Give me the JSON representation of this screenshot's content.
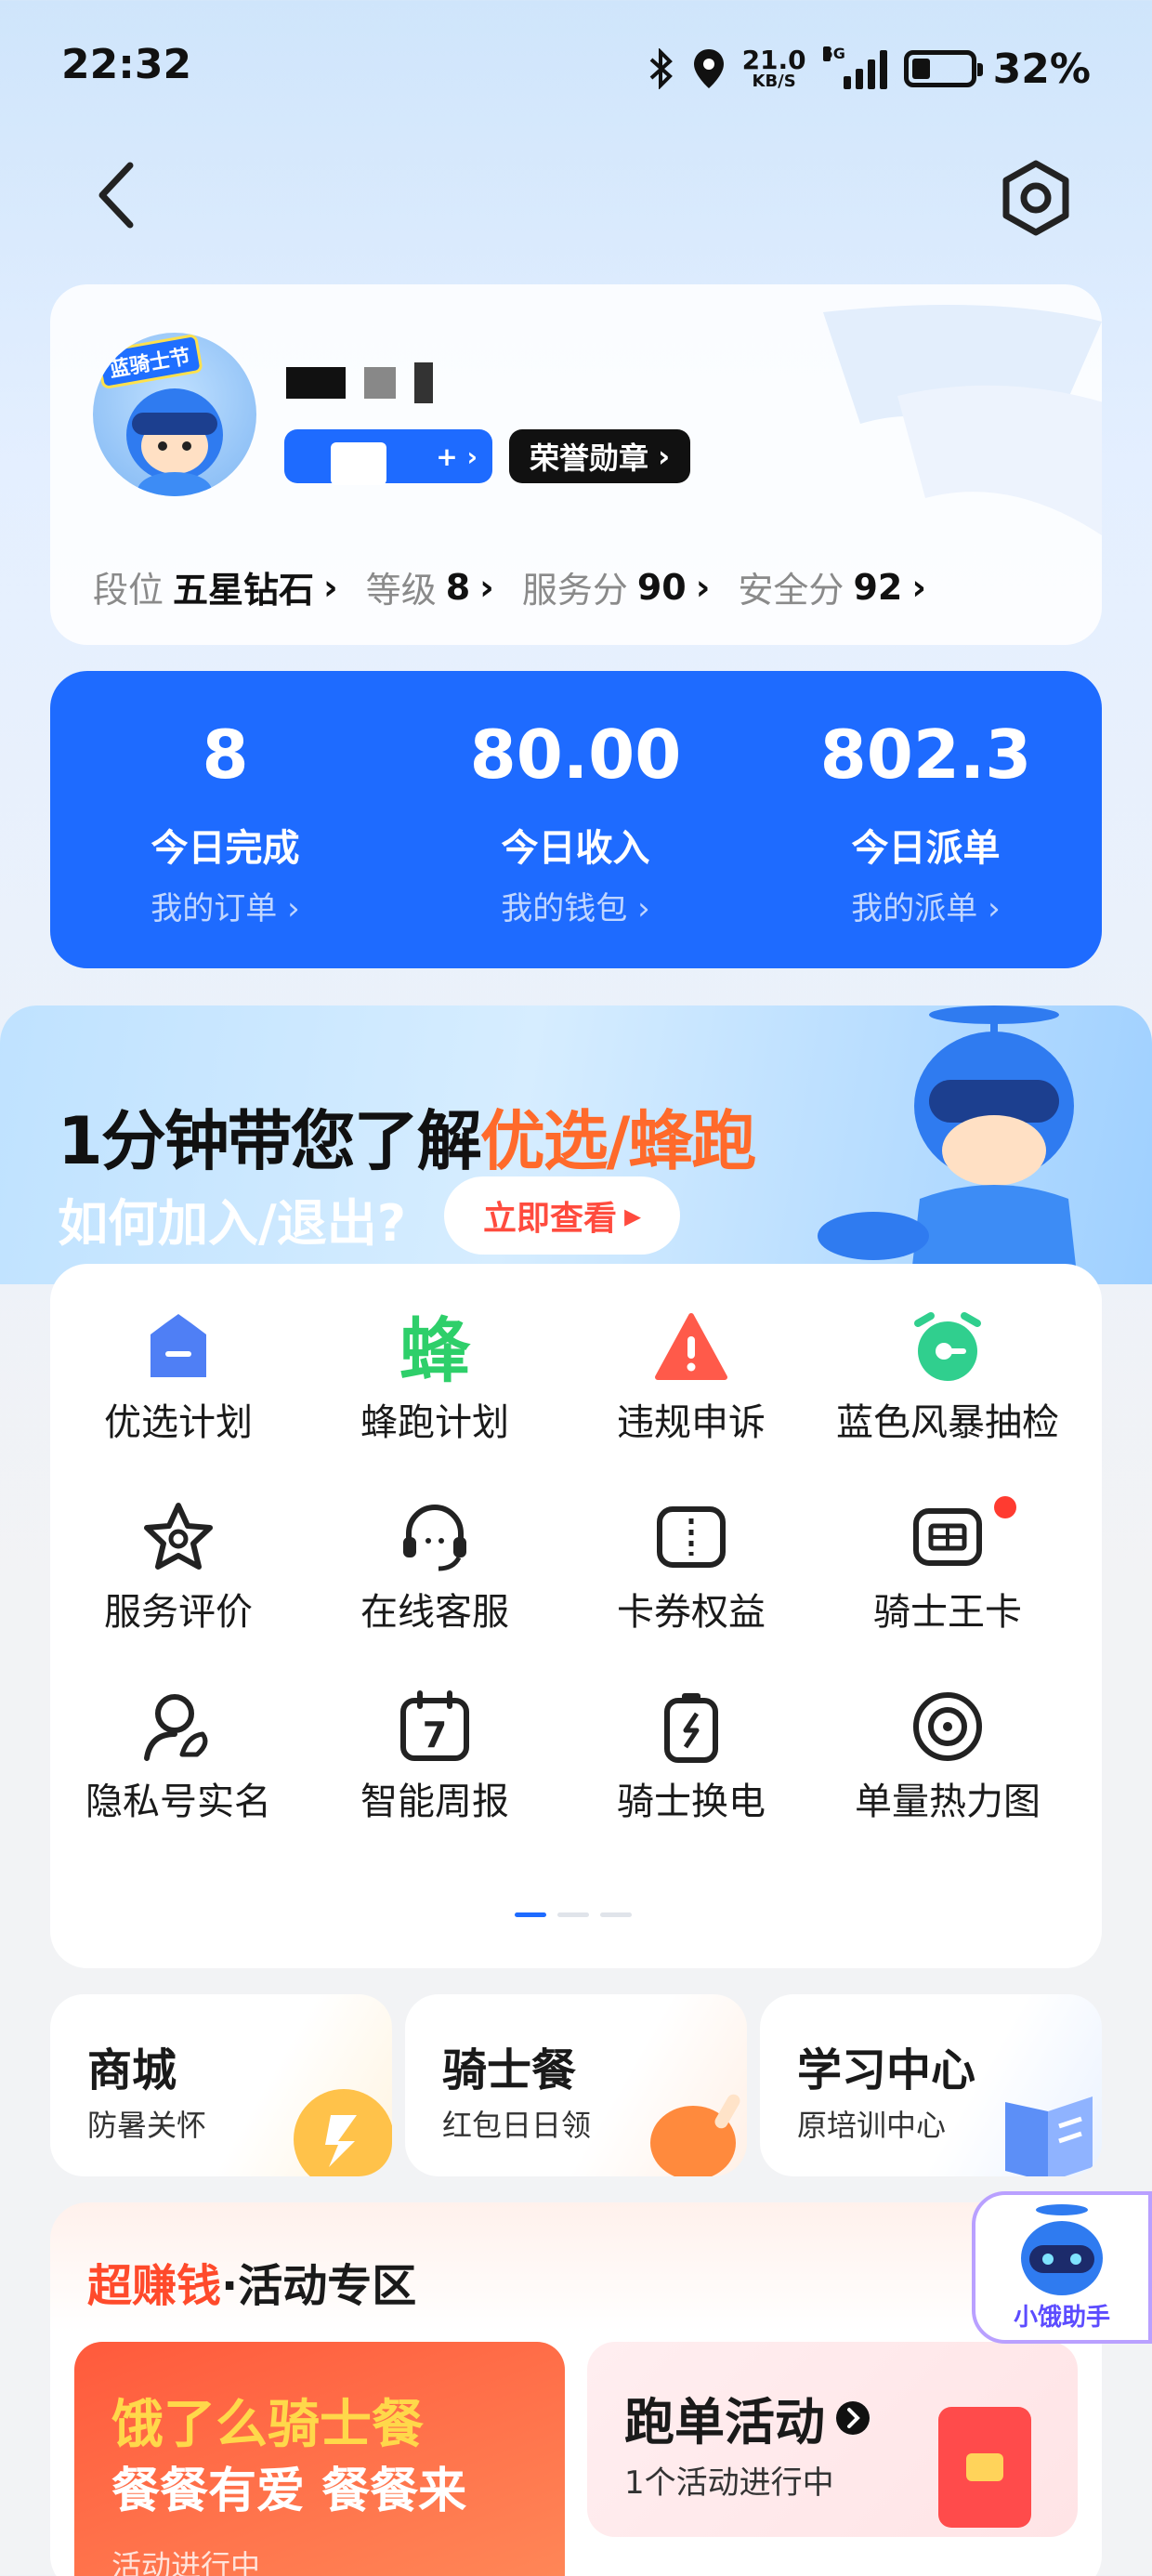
{
  "status": {
    "time": "22:32",
    "net_speed": "21.0",
    "net_unit": "KB/S",
    "network": "5G",
    "battery": "32%",
    "battery_level": 0.32
  },
  "nav": {
    "back": "back",
    "settings": "settings"
  },
  "profile": {
    "avatar_tag": "蓝骑士节",
    "level_suffix": "+",
    "honor": "荣誉勋章",
    "stats": [
      {
        "label": "段位",
        "value": "五星钻石"
      },
      {
        "label": "等级",
        "value": "8"
      },
      {
        "label": "服务分",
        "value": "90"
      },
      {
        "label": "安全分",
        "value": "92"
      }
    ]
  },
  "today": [
    {
      "value": "8",
      "label": "今日完成",
      "link": "我的订单"
    },
    {
      "value": "80.00",
      "label": "今日收入",
      "link": "我的钱包"
    },
    {
      "value": "802.3",
      "label": "今日派单",
      "link": "我的派单"
    }
  ],
  "banner": {
    "title_a": "1分钟带您了解",
    "title_b": "优选/蜂跑",
    "subtitle": "如何加入/退出?",
    "cta": "立即查看"
  },
  "grid": [
    {
      "icon": "crown-icon",
      "label": "优选计划"
    },
    {
      "icon": "bee-char-icon",
      "label": "蜂跑计划",
      "glyph": "蜂"
    },
    {
      "icon": "warning-icon",
      "label": "违规申诉"
    },
    {
      "icon": "alarm-clock-icon",
      "label": "蓝色风暴抽检"
    },
    {
      "icon": "star-badge-icon",
      "label": "服务评价"
    },
    {
      "icon": "headset-icon",
      "label": "在线客服"
    },
    {
      "icon": "coupon-icon",
      "label": "卡券权益"
    },
    {
      "icon": "card-icon",
      "label": "骑士王卡"
    },
    {
      "icon": "user-verify-icon",
      "label": "隐私号实名"
    },
    {
      "icon": "calendar-icon",
      "label": "智能周报",
      "glyph": "7"
    },
    {
      "icon": "battery-swap-icon",
      "label": "骑士换电"
    },
    {
      "icon": "heatmap-icon",
      "label": "单量热力图"
    }
  ],
  "mini_cards": [
    {
      "title": "商城",
      "sub": "防暑关怀"
    },
    {
      "title": "骑士餐",
      "sub": "红包日日领"
    },
    {
      "title": "学习中心",
      "sub": "原培训中心"
    }
  ],
  "activity": {
    "header_a": "超赚钱",
    "header_b": "·活动专区",
    "left_l1": "饿了么骑士餐",
    "left_l2": "餐餐有爱 餐餐来",
    "left_l3": "活动进行中",
    "right_title": "跑单活动",
    "right_sub": "1个活动进行中"
  },
  "helper": {
    "label": "小饿助手"
  },
  "colors": {
    "accent": "#1e6bff",
    "orange": "#ff6a2b",
    "red": "#ff4b3e"
  }
}
